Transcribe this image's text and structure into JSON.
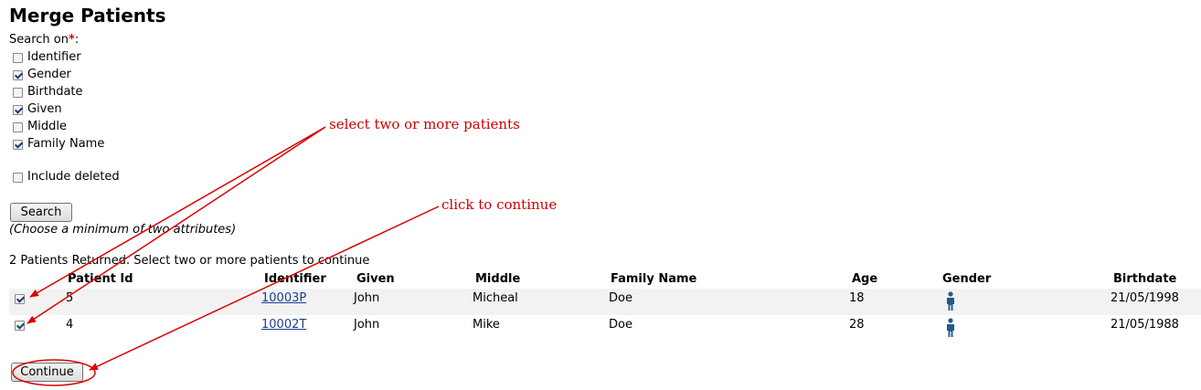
{
  "page": {
    "title": "Merge Patients",
    "search_on_label": "Search on",
    "required_mark": "*",
    "colon": ":"
  },
  "search_fields": [
    {
      "label": "Identifier",
      "checked": false
    },
    {
      "label": "Gender",
      "checked": true
    },
    {
      "label": "Birthdate",
      "checked": false
    },
    {
      "label": "Given",
      "checked": true
    },
    {
      "label": "Middle",
      "checked": false
    },
    {
      "label": "Family Name",
      "checked": true
    }
  ],
  "include_deleted": {
    "label": "Include deleted",
    "checked": false
  },
  "search_button": "Search",
  "hint": "(Choose a minimum of two attributes)",
  "results_message": "2 Patients Returned. Select two or more patients to continue",
  "table": {
    "headers": [
      "Patient Id",
      "Identifier",
      "Given",
      "Middle",
      "Family Name",
      "Age",
      "Gender",
      "Birthdate"
    ],
    "rows": [
      {
        "checked": true,
        "patient_id": "5",
        "identifier": "10003P",
        "given": "John",
        "middle": "Micheal",
        "family_name": "Doe",
        "age": "18",
        "gender_icon": "male-person-icon",
        "birthdate": "21/05/1998"
      },
      {
        "checked": true,
        "patient_id": "4",
        "identifier": "10002T",
        "given": "John",
        "middle": "Mike",
        "family_name": "Doe",
        "age": "28",
        "gender_icon": "male-person-icon",
        "birthdate": "21/05/1988"
      }
    ]
  },
  "continue_button": "Continue",
  "annotations": {
    "select_patients": "select two or more patients",
    "click_continue": "click to continue",
    "color": "#dd0000"
  },
  "colors": {
    "link": "#1a3f8f",
    "gender_icon": "#1f5c8c",
    "row_alt": "#f2f2f2"
  }
}
